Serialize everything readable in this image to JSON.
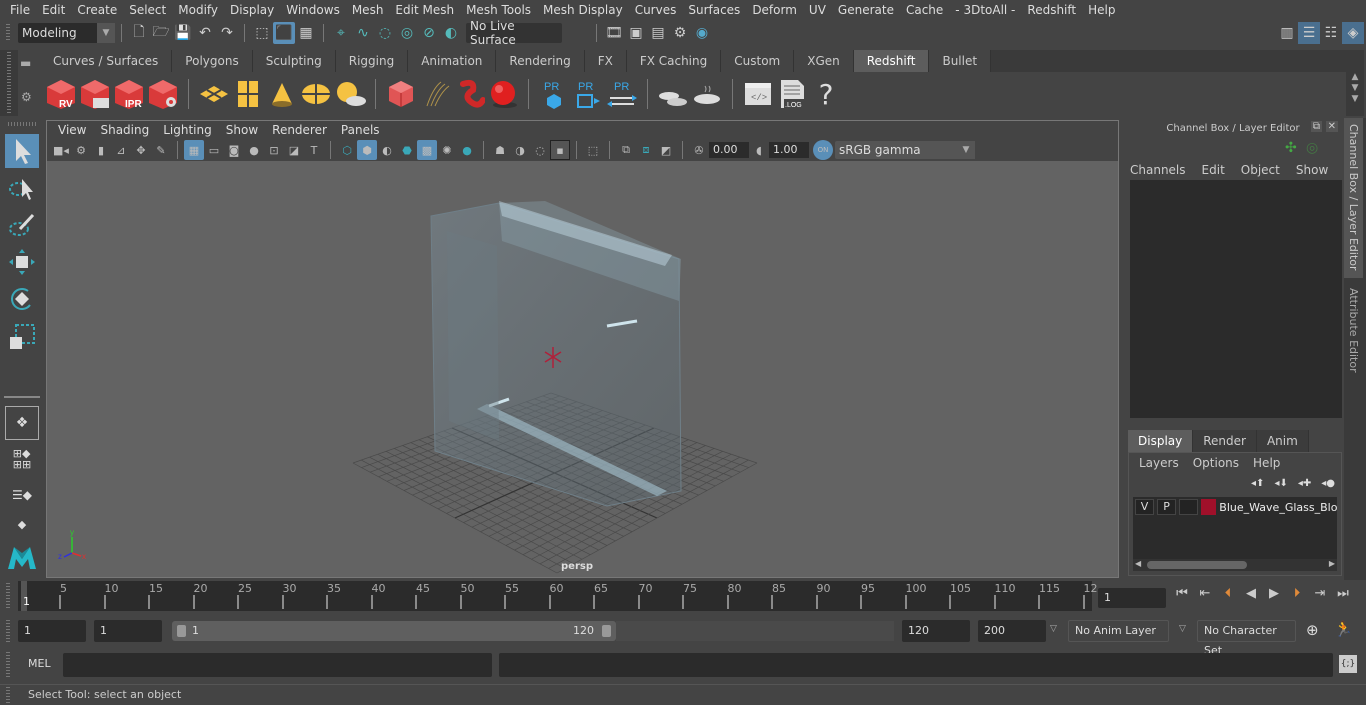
{
  "menubar": {
    "items": [
      "File",
      "Edit",
      "Create",
      "Select",
      "Modify",
      "Display",
      "Windows",
      "Mesh",
      "Edit Mesh",
      "Mesh Tools",
      "Mesh Display",
      "Curves",
      "Surfaces",
      "Deform",
      "UV",
      "Generate",
      "Cache",
      "- 3DtoAll -",
      "Redshift",
      "Help"
    ]
  },
  "toolbar": {
    "workspace": "Modeling",
    "live_surface": "No Live Surface"
  },
  "shelf": {
    "tabs": [
      "Curves / Surfaces",
      "Polygons",
      "Sculpting",
      "Rigging",
      "Animation",
      "Rendering",
      "FX",
      "FX Caching",
      "Custom",
      "XGen",
      "Redshift",
      "Bullet"
    ],
    "active_tab": "Redshift",
    "icons": [
      "rs-render-view-icon",
      "rs-batch-render-icon",
      "rs-ipr-icon",
      "rs-settings-icon",
      "rs-area-light-icon",
      "rs-portal-light-icon",
      "rs-spot-light-icon",
      "rs-dome-light-icon",
      "rs-sun-sky-icon",
      "rs-mesh-proxy-icon",
      "rs-hair-icon",
      "rs-volume-icon",
      "rs-sphere-icon",
      "pr-object-icon",
      "pr-export-icon",
      "pr-convert-icon",
      "baking-icon",
      "bake-set-icon",
      "script-editor-icon",
      "log-icon",
      "help-icon"
    ],
    "labels": {
      "rv": "RV",
      "ipr": "IPR",
      "pr": "PR",
      "log": ".LOG",
      "help": "?"
    }
  },
  "viewport": {
    "menu": [
      "View",
      "Shading",
      "Lighting",
      "Show",
      "Renderer",
      "Panels"
    ],
    "exposure": "0.00",
    "gamma": "1.00",
    "color_space": "sRGB gamma",
    "on_label": "ON",
    "camera_label": "persp",
    "axis": {
      "x": "x",
      "y": "y",
      "z": "z"
    }
  },
  "channel_box": {
    "title": "Channel Box / Layer Editor",
    "menu": [
      "Channels",
      "Edit",
      "Object",
      "Show"
    ]
  },
  "layer_editor": {
    "tabs": [
      "Display",
      "Render",
      "Anim"
    ],
    "active_tab": "Display",
    "menu": [
      "Layers",
      "Options",
      "Help"
    ],
    "layers": [
      {
        "v": "V",
        "p": "P",
        "color": "#a0102a",
        "name": "Blue_Wave_Glass_Bloc"
      }
    ]
  },
  "side_tabs": [
    "Channel Box / Layer Editor",
    "Attribute Editor"
  ],
  "timeline": {
    "start_marker": "1",
    "ticks": [
      "5",
      "10",
      "15",
      "20",
      "25",
      "30",
      "35",
      "40",
      "45",
      "50",
      "55",
      "60",
      "65",
      "70",
      "75",
      "80",
      "85",
      "90",
      "95",
      "100",
      "105",
      "110",
      "115",
      "12"
    ],
    "current_frame": "1"
  },
  "range": {
    "start": "1",
    "playback_start": "1",
    "slider_start": "1",
    "slider_end": "120",
    "playback_end": "120",
    "end": "200",
    "anim_layer": "No Anim Layer",
    "character_set": "No Character Set"
  },
  "command_line": {
    "label": "MEL",
    "value": "",
    "result": ""
  },
  "status": {
    "help_line": "Select Tool: select an object"
  }
}
